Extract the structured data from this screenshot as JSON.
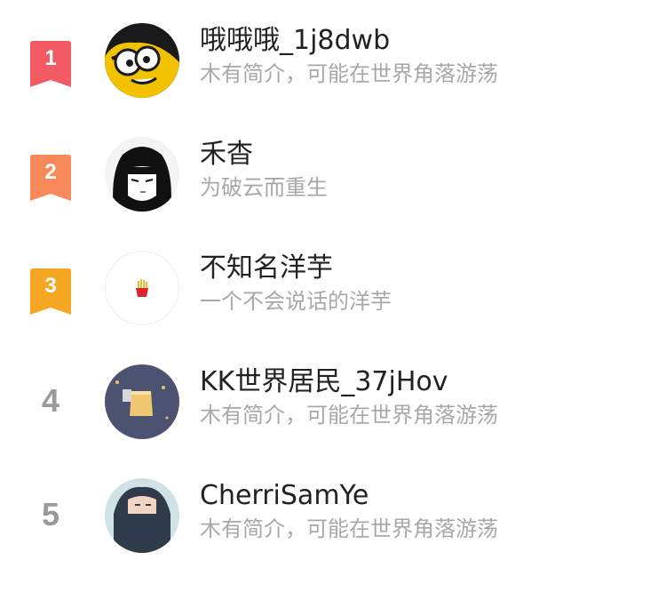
{
  "colors": {
    "rank1": "#f25b63",
    "rank2": "#f7895a",
    "rank3": "#f5a623",
    "name": "#222222",
    "bio": "#a8a8a8",
    "rank_plain": "#9a9a9a"
  },
  "ranking": [
    {
      "rank": "1",
      "name": "哦哦哦_1j8dwb",
      "bio": "木有简介，可能在世界角落游荡",
      "avatar": "cartoon-face-avatar"
    },
    {
      "rank": "2",
      "name": "禾杳",
      "bio": "为破云而重生",
      "avatar": "manga-girl-avatar"
    },
    {
      "rank": "3",
      "name": "不知名洋芋",
      "bio": "一个不会说话的洋芋",
      "avatar": "fries-avatar"
    },
    {
      "rank": "4",
      "name": "KK世界居民_37jHov",
      "bio": "木有简介，可能在世界角落游荡",
      "avatar": "sky-lantern-avatar"
    },
    {
      "rank": "5",
      "name": "CherriSamYe",
      "bio": "木有简介，可能在世界角落游荡",
      "avatar": "anime-couple-avatar"
    }
  ]
}
